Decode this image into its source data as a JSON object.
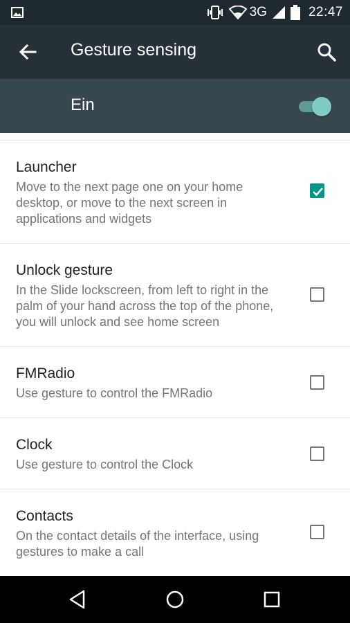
{
  "status_bar": {
    "network": "3G",
    "time": "22:47",
    "icons": [
      "image-icon",
      "vibrate-icon",
      "wifi-icon",
      "signal-icon",
      "battery-icon"
    ]
  },
  "toolbar": {
    "title": "Gesture sensing",
    "back_icon": "arrow-back-icon",
    "search_icon": "search-icon"
  },
  "master_switch": {
    "label": "Ein",
    "state": "on"
  },
  "items": [
    {
      "title": "Launcher",
      "summary": "Move to the next page one on your home desktop, or move to the next screen in applications and widgets",
      "checked": true
    },
    {
      "title": "Unlock gesture",
      "summary": "In the Slide lockscreen, from left to right in the palm of your hand across the top of the phone, you will unlock and see home screen",
      "checked": false
    },
    {
      "title": "FMRadio",
      "summary": "Use gesture to control the FMRadio",
      "checked": false
    },
    {
      "title": "Clock",
      "summary": "Use gesture to control the Clock",
      "checked": false
    },
    {
      "title": "Contacts",
      "summary": "On the contact details of the interface, using gestures to make a call",
      "checked": false
    }
  ],
  "nav_bar": {
    "icons": [
      "back-triangle-icon",
      "home-circle-icon",
      "recents-square-icon"
    ]
  },
  "colors": {
    "status_bar": "#1e2a30",
    "toolbar": "#263238",
    "switch_bar": "#37474f",
    "accent": "#009688",
    "switch_thumb": "#80cbc4"
  }
}
